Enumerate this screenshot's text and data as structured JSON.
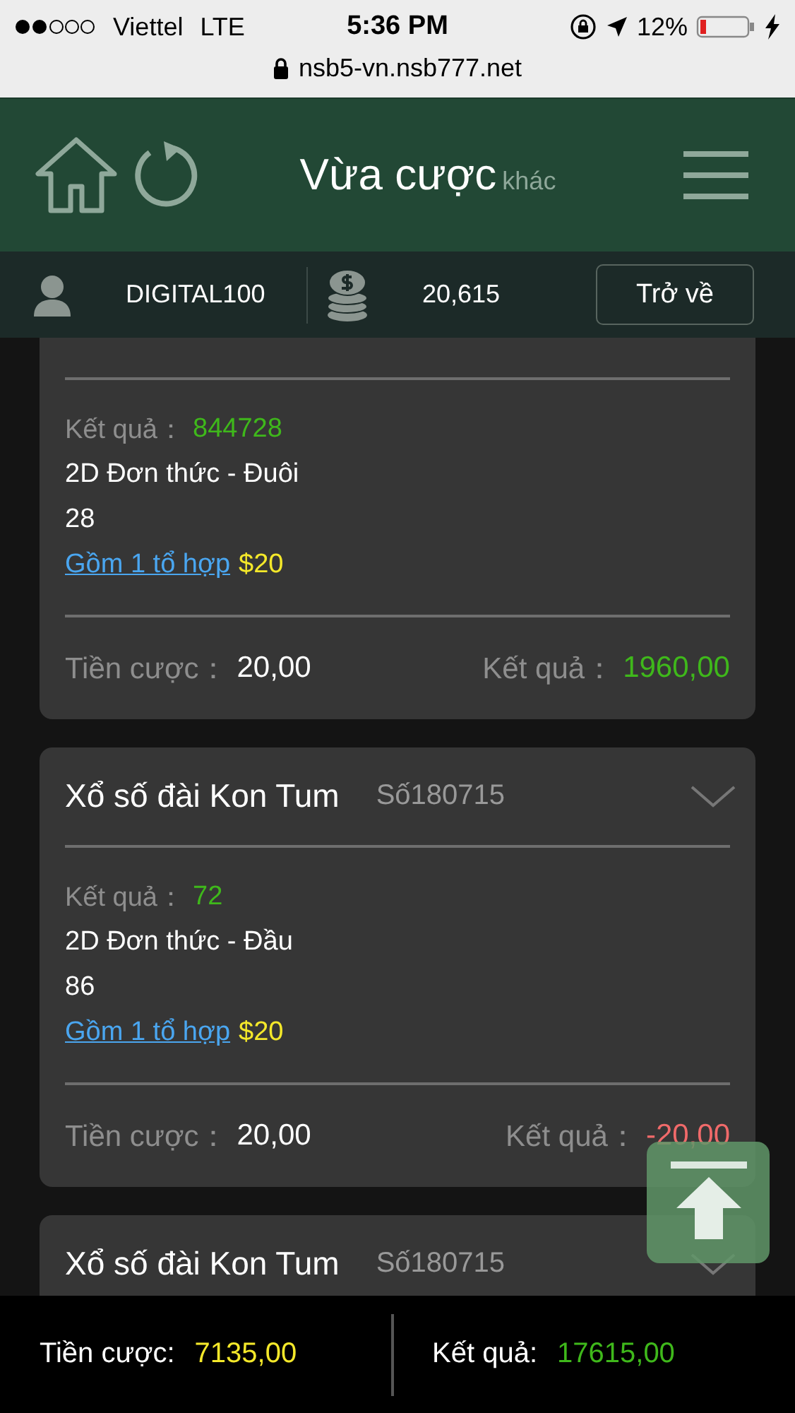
{
  "status_bar": {
    "carrier": "Viettel",
    "network": "LTE",
    "time": "5:36 PM",
    "battery": "12%"
  },
  "address_bar": {
    "url": "nsb5-vn.nsb777.net"
  },
  "header": {
    "title": "Vừa cược",
    "subtitle": "khác"
  },
  "account_bar": {
    "username": "DIGITAL100",
    "balance": "20,615",
    "back_button": "Trở về"
  },
  "bets": [
    {
      "kind": "partial",
      "result_label": "Kết quả：",
      "result": "844728",
      "bet_type": "2D Đơn thức - Đuôi",
      "number": "28",
      "combo_link": "Gồm 1 tổ hợp",
      "combo_amount": "$20",
      "stake_label": "Tiền cược：",
      "stake": "20,00",
      "payout_label": "Kết quả：",
      "payout": "1960,00",
      "color": "#3fb81b"
    },
    {
      "kind": "full",
      "title": "Xổ số đài Kon Tum",
      "draw": "Số180715",
      "result_label": "Kết quả：",
      "result": "72",
      "bet_type": "2D Đơn thức - Đầu",
      "number": "86",
      "combo_link": "Gồm 1 tổ hợp",
      "combo_amount": "$20",
      "stake_label": "Tiền cược：",
      "stake": "20,00",
      "payout_label": "Kết quả：",
      "payout": "-20,00",
      "color": "#f06a6a"
    },
    {
      "kind": "header",
      "title": "Xổ số đài Kon Tum",
      "draw": "Số180715"
    }
  ],
  "totals": {
    "stake_label": "Tiền cược:",
    "stake": "7135,00",
    "payout_label": "Kết quả:",
    "payout": "17615,00"
  }
}
